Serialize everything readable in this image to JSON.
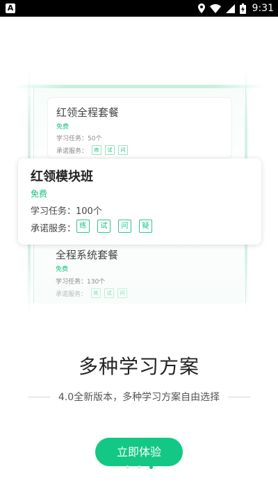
{
  "status_bar": {
    "time": "9:31",
    "app_icon_letter": "A",
    "icons": [
      "location-icon",
      "wifi-icon",
      "signal-icon",
      "battery-icon"
    ]
  },
  "plans": {
    "card1": {
      "title": "红领全程套餐",
      "price": "免费",
      "tasks": "学习任务：50个",
      "services_label": "承诺服务：",
      "services": [
        "练",
        "试",
        "问"
      ]
    },
    "main": {
      "title": "红领模块班",
      "price": "免费",
      "tasks": "学习任务：100个",
      "services_label": "承诺服务：",
      "services": [
        "练",
        "试",
        "问",
        "疑"
      ]
    },
    "card3": {
      "title": "全程系统套餐",
      "price": "免费",
      "tasks": "学习任务：130个",
      "services_label": "承诺服务：",
      "services": [
        "练",
        "试",
        "问"
      ]
    }
  },
  "headline": "多种学习方案",
  "subtitle": "4.0全新版本，多种学习方案自由选择",
  "cta_label": "立即体验",
  "pager": {
    "total": 3,
    "active": 3
  },
  "colors": {
    "accent": "#13c784"
  }
}
